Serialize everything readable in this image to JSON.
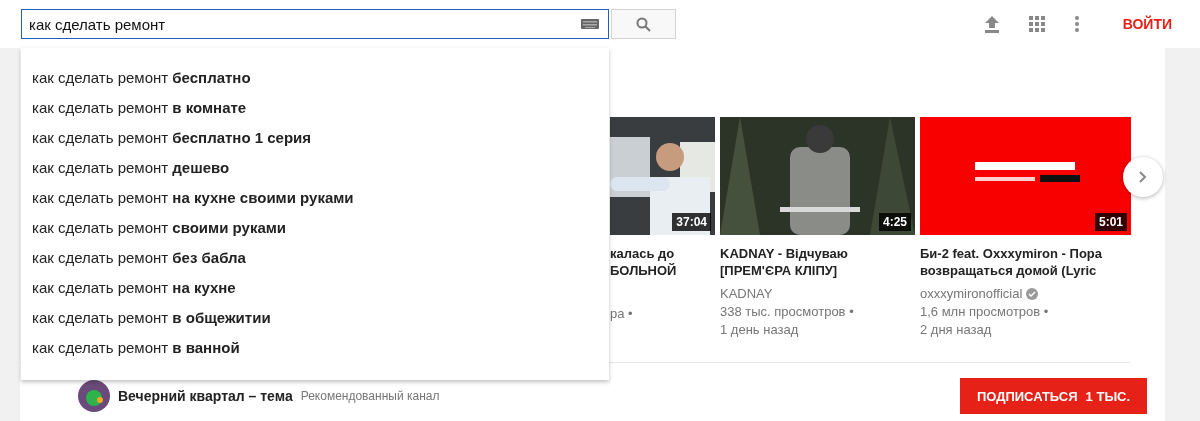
{
  "search": {
    "value": "как сделать ремонт"
  },
  "header": {
    "login": "ВОЙТИ"
  },
  "suggestions": [
    "как сделать ремонт **бесплатно**",
    "как сделать ремонт **в комнате**",
    "как сделать ремонт **бесплатно 1 серия**",
    "как сделать ремонт **дешево**",
    "как сделать ремонт **на кухне своими руками**",
    "как сделать ремонт **своими руками**",
    "как сделать ремонт **без бабла**",
    "как сделать ремонт **на кухне**",
    "как сделать ремонт **в общежитии**",
    "как сделать ремонт **в ванной**"
  ],
  "videos": [
    {
      "kind": "picture",
      "duration": "37:04",
      "title_lines": [
        "калась до",
        "БОЛЬНОЙ"
      ],
      "meta": [
        "ра •"
      ],
      "verified": false
    },
    {
      "kind": "picture",
      "duration": "4:25",
      "title_lines": [
        "KADNAY - Відчуваю",
        "[ПРЕМ'ЄРА КЛІПУ]"
      ],
      "channel": "KADNAY",
      "meta": [
        "338 тыс. просмотров •",
        "1 день назад"
      ],
      "verified": false
    },
    {
      "kind": "picture",
      "duration": "5:01",
      "title_lines": [
        "Би-2 feat. Oxxxymiron - Пора",
        "возвращаться домой (Lyric"
      ],
      "channel": "oxxxymironofficial",
      "meta": [
        "1,6 млн просмотров •",
        "2 дня назад"
      ],
      "verified": true
    }
  ],
  "channel_shelf": {
    "name": "Вечерний квартал – тема",
    "note": "Рекомендованный канал",
    "subscribe": "ПОДПИСАТЬСЯ",
    "subscribers": "1 ТЫС."
  }
}
